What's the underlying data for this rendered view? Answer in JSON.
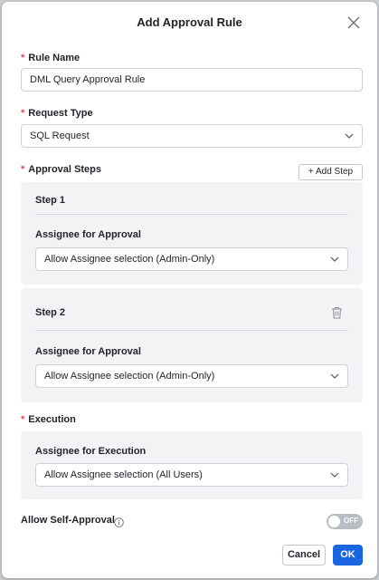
{
  "dialog": {
    "title": "Add Approval Rule"
  },
  "fields": {
    "rule_name": {
      "required_mark": "*",
      "label": "Rule Name",
      "value": "DML Query Approval Rule"
    },
    "request_type": {
      "required_mark": "*",
      "label": "Request Type",
      "value": "SQL Request"
    },
    "approval_steps": {
      "required_mark": "*",
      "label": "Approval Steps",
      "add_step_label": "+ Add Step",
      "steps": [
        {
          "title": "Step 1",
          "assignee_label": "Assignee for Approval",
          "assignee_value": "Allow Assignee selection (Admin-Only)",
          "deletable": false
        },
        {
          "title": "Step 2",
          "assignee_label": "Assignee for Approval",
          "assignee_value": "Allow Assignee selection (Admin-Only)",
          "deletable": true
        }
      ]
    },
    "execution": {
      "required_mark": "*",
      "label": "Execution",
      "assignee_label": "Assignee for Execution",
      "assignee_value": "Allow Assignee selection (All Users)"
    },
    "self_approval": {
      "label": "Allow Self-Approval",
      "toggle_text": "OFF",
      "enabled": false
    }
  },
  "footer": {
    "cancel_label": "Cancel",
    "ok_label": "OK"
  },
  "colors": {
    "primary": "#1a66e0",
    "required": "#e5484d",
    "panel": "#f2f3f5",
    "toggle_off": "#b8bcc3"
  },
  "icons": [
    "close-icon",
    "chevron-down-icon",
    "trash-icon",
    "info-icon"
  ]
}
